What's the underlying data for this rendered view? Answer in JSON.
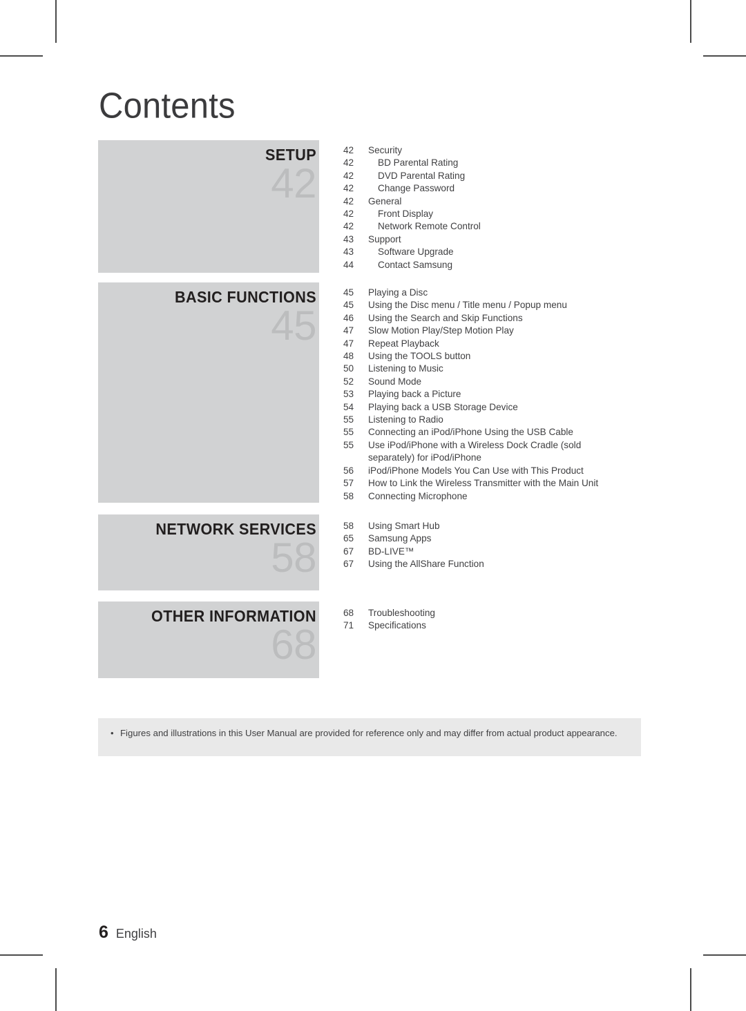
{
  "page": {
    "title": "Contents",
    "footer_page_number": "6",
    "footer_language": "English"
  },
  "sections": [
    {
      "label": "SETUP",
      "number": "42",
      "entries": [
        {
          "page": "42",
          "text": "Security",
          "level": 1
        },
        {
          "page": "42",
          "text": "BD Parental Rating",
          "level": 2
        },
        {
          "page": "42",
          "text": "DVD Parental Rating",
          "level": 2
        },
        {
          "page": "42",
          "text": "Change Password",
          "level": 2
        },
        {
          "page": "42",
          "text": "General",
          "level": 1
        },
        {
          "page": "42",
          "text": "Front Display",
          "level": 2
        },
        {
          "page": "42",
          "text": "Network Remote Control",
          "level": 2
        },
        {
          "page": "43",
          "text": "Support",
          "level": 1
        },
        {
          "page": "43",
          "text": "Software Upgrade",
          "level": 2
        },
        {
          "page": "44",
          "text": "Contact Samsung",
          "level": 2
        }
      ]
    },
    {
      "label": "BASIC FUNCTIONS",
      "number": "45",
      "entries": [
        {
          "page": "45",
          "text": "Playing a Disc",
          "level": 1
        },
        {
          "page": "45",
          "text": "Using the Disc menu / Title menu / Popup menu",
          "level": 1
        },
        {
          "page": "46",
          "text": "Using the Search and Skip Functions",
          "level": 1
        },
        {
          "page": "47",
          "text": "Slow Motion Play/Step Motion Play",
          "level": 1
        },
        {
          "page": "47",
          "text": "Repeat Playback",
          "level": 1
        },
        {
          "page": "48",
          "text": "Using the TOOLS button",
          "level": 1
        },
        {
          "page": "50",
          "text": "Listening to Music",
          "level": 1
        },
        {
          "page": "52",
          "text": "Sound Mode",
          "level": 1
        },
        {
          "page": "53",
          "text": "Playing back a Picture",
          "level": 1
        },
        {
          "page": "54",
          "text": "Playing back a USB Storage Device",
          "level": 1
        },
        {
          "page": "55",
          "text": "Listening to Radio",
          "level": 1
        },
        {
          "page": "55",
          "text": "Connecting an iPod/iPhone Using the USB Cable",
          "level": 1
        },
        {
          "page": "55",
          "text": "Use iPod/iPhone with a Wireless Dock Cradle (sold",
          "level": 1
        },
        {
          "page": "",
          "text": "separately) for iPod/iPhone",
          "level": 1,
          "continuation": true
        },
        {
          "page": "56",
          "text": "iPod/iPhone Models You Can Use with This Product",
          "level": 1
        },
        {
          "page": "57",
          "text": "How to Link the Wireless Transmitter with the Main Unit",
          "level": 1
        },
        {
          "page": "58",
          "text": "Connecting Microphone",
          "level": 1
        }
      ]
    },
    {
      "label": "NETWORK SERVICES",
      "number": "58",
      "entries": [
        {
          "page": "58",
          "text": "Using Smart Hub",
          "level": 1
        },
        {
          "page": "65",
          "text": "Samsung Apps",
          "level": 1
        },
        {
          "page": "67",
          "text": "BD-LIVE™",
          "level": 1
        },
        {
          "page": "67",
          "text": "Using the AllShare Function",
          "level": 1
        }
      ]
    },
    {
      "label": "OTHER INFORMATION",
      "number": "68",
      "entries": [
        {
          "page": "68",
          "text": "Troubleshooting",
          "level": 1
        },
        {
          "page": "71",
          "text": "Specifications",
          "level": 1
        }
      ]
    }
  ],
  "note": {
    "bullet": "•",
    "text": "Figures and illustrations in this User Manual are provided for reference only and may differ from actual product appearance."
  },
  "colors": {
    "block_background": "#d1d2d3",
    "block_number": "#bcbdbe",
    "note_background": "#e9e9e9",
    "text": "#3f3f41",
    "heading": "#221f1f"
  }
}
